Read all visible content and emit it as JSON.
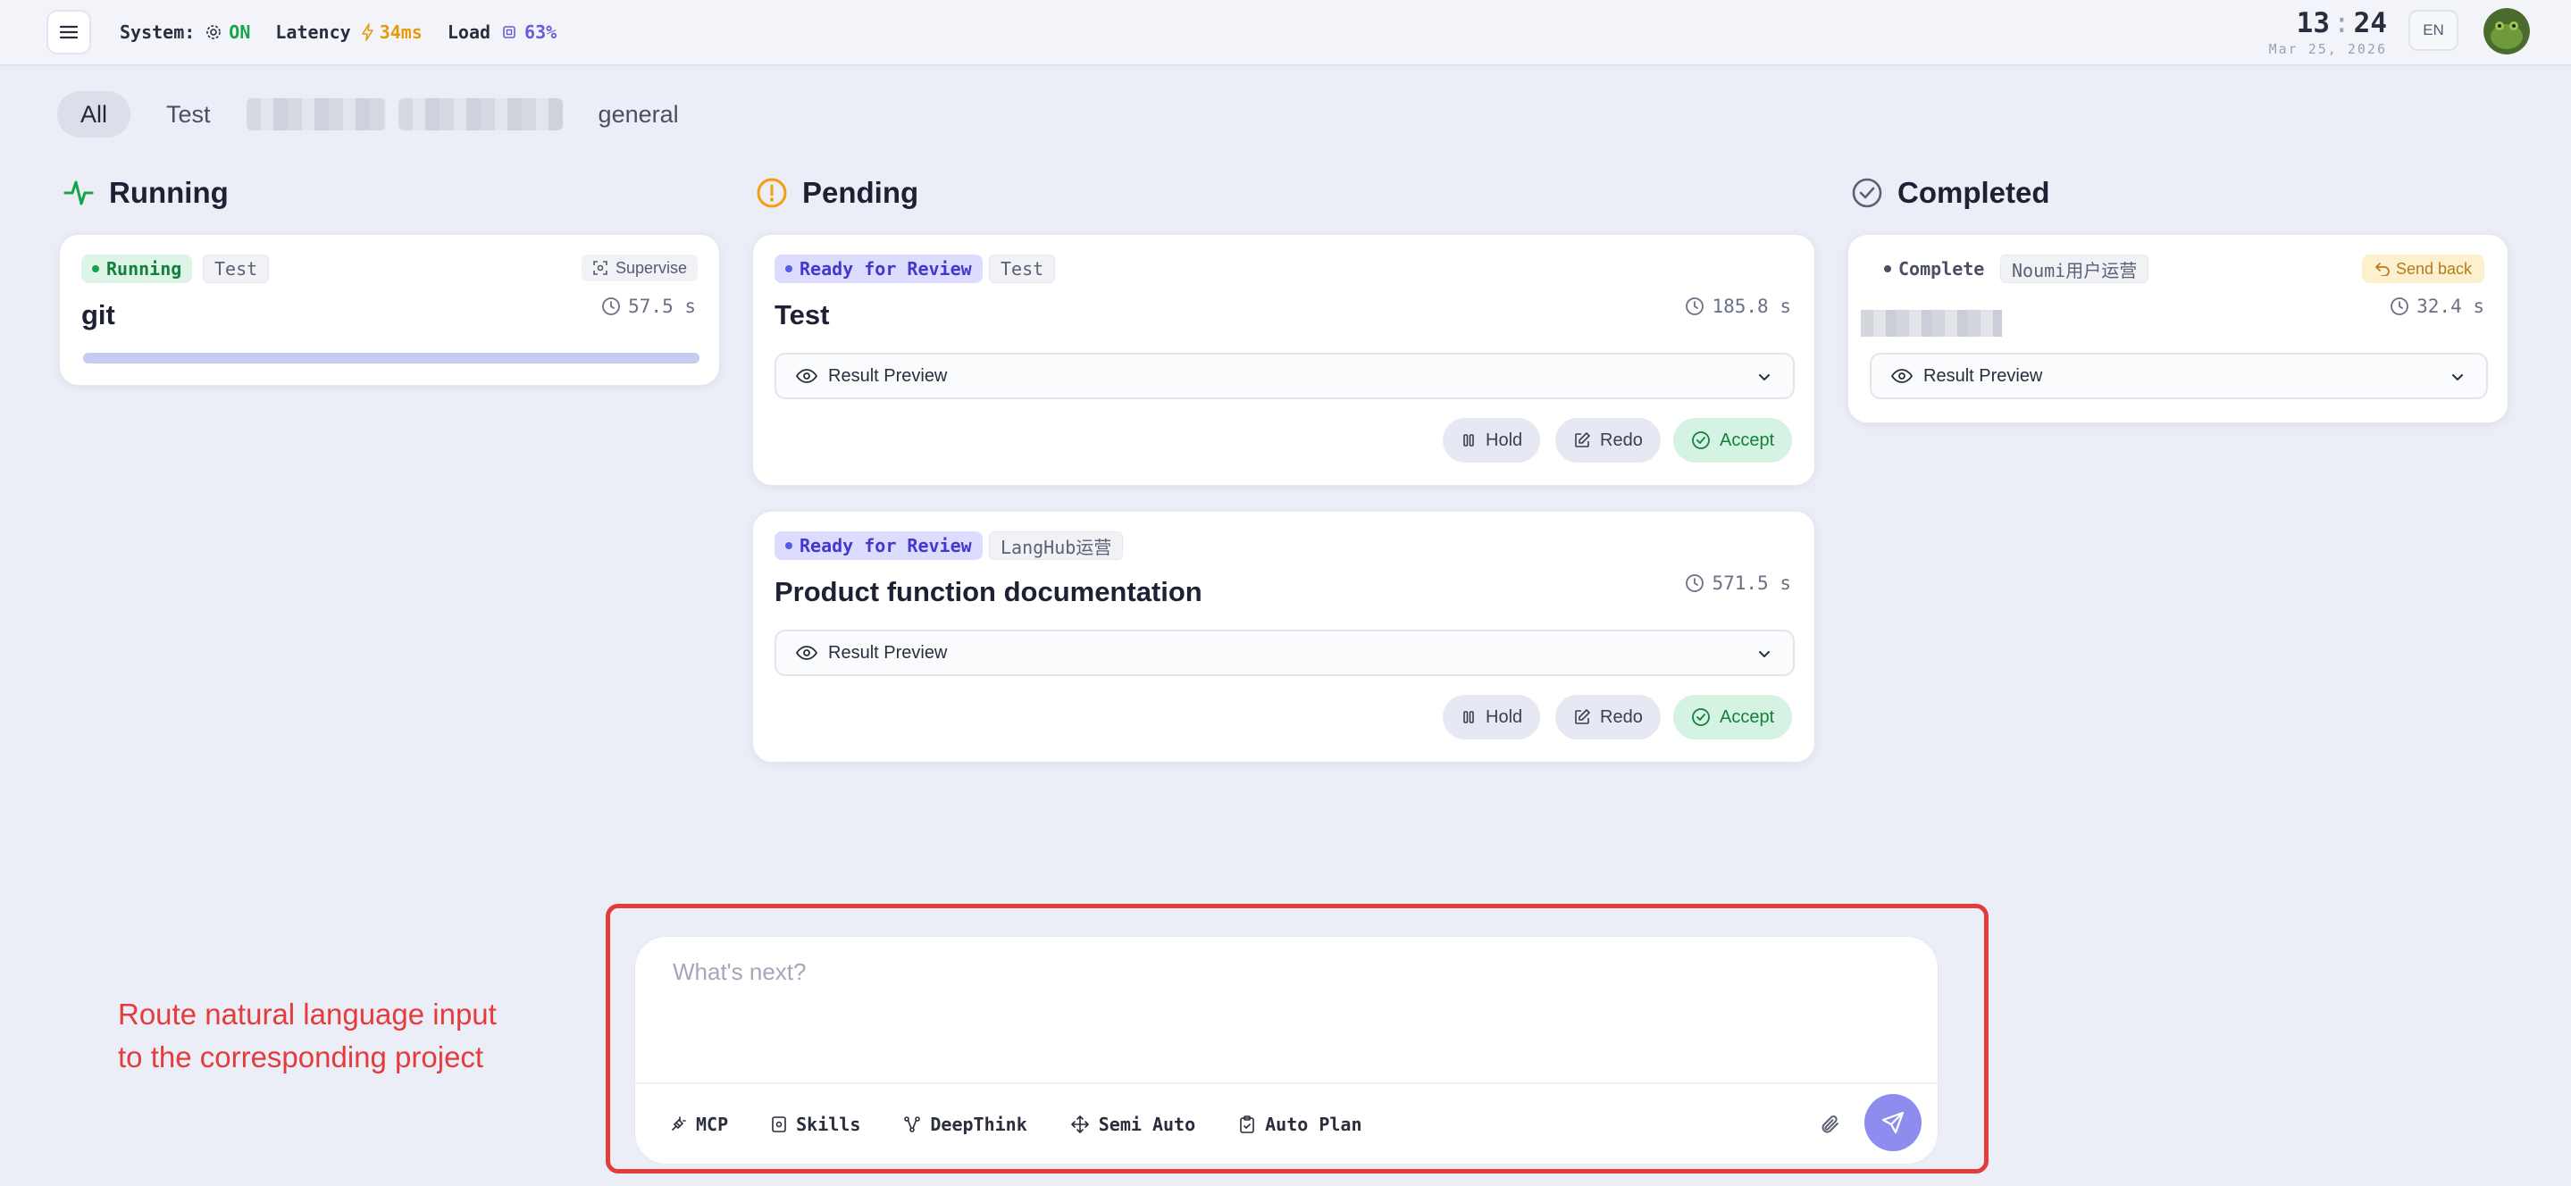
{
  "topbar": {
    "system_label": "System:",
    "system_value": "ON",
    "latency_label": "Latency",
    "latency_value": "34ms",
    "load_label": "Load",
    "load_value": "63%",
    "clock_hour": "13",
    "clock_minute": "24",
    "date": "Mar 25, 2026",
    "lang": "EN"
  },
  "tabs": [
    "All",
    "Test",
    "general"
  ],
  "columns": {
    "running": "Running",
    "pending": "Pending",
    "completed": "Completed"
  },
  "cards": {
    "running": {
      "status": "Running",
      "tag": "Test",
      "action": "Supervise",
      "title": "git",
      "time": "57.5 s",
      "progress": 1.0
    },
    "pending1": {
      "status": "Ready for Review",
      "tag": "Test",
      "title": "Test",
      "time": "185.8 s",
      "preview": "Result Preview",
      "hold": "Hold",
      "redo": "Redo",
      "accept": "Accept"
    },
    "pending2": {
      "status": "Ready for Review",
      "tag": "LangHub运营",
      "title": "Product function documentation",
      "time": "571.5 s",
      "preview": "Result Preview",
      "hold": "Hold",
      "redo": "Redo",
      "accept": "Accept"
    },
    "completed": {
      "status": "Complete",
      "tag": "Noumi用户运营",
      "action": "Send back",
      "time": "32.4 s",
      "preview": "Result Preview"
    }
  },
  "composer": {
    "placeholder": "What's next?",
    "tools": [
      "MCP",
      "Skills",
      "DeepThink",
      "Semi Auto",
      "Auto Plan"
    ]
  },
  "annotation": {
    "line1": "Route natural language input",
    "line2": "to the corresponding project"
  },
  "colors": {
    "accent": "#8f8cf0",
    "running_green": "#16a34a",
    "pending_orange": "#f59e0b",
    "highlight_red": "#e53b3b"
  }
}
